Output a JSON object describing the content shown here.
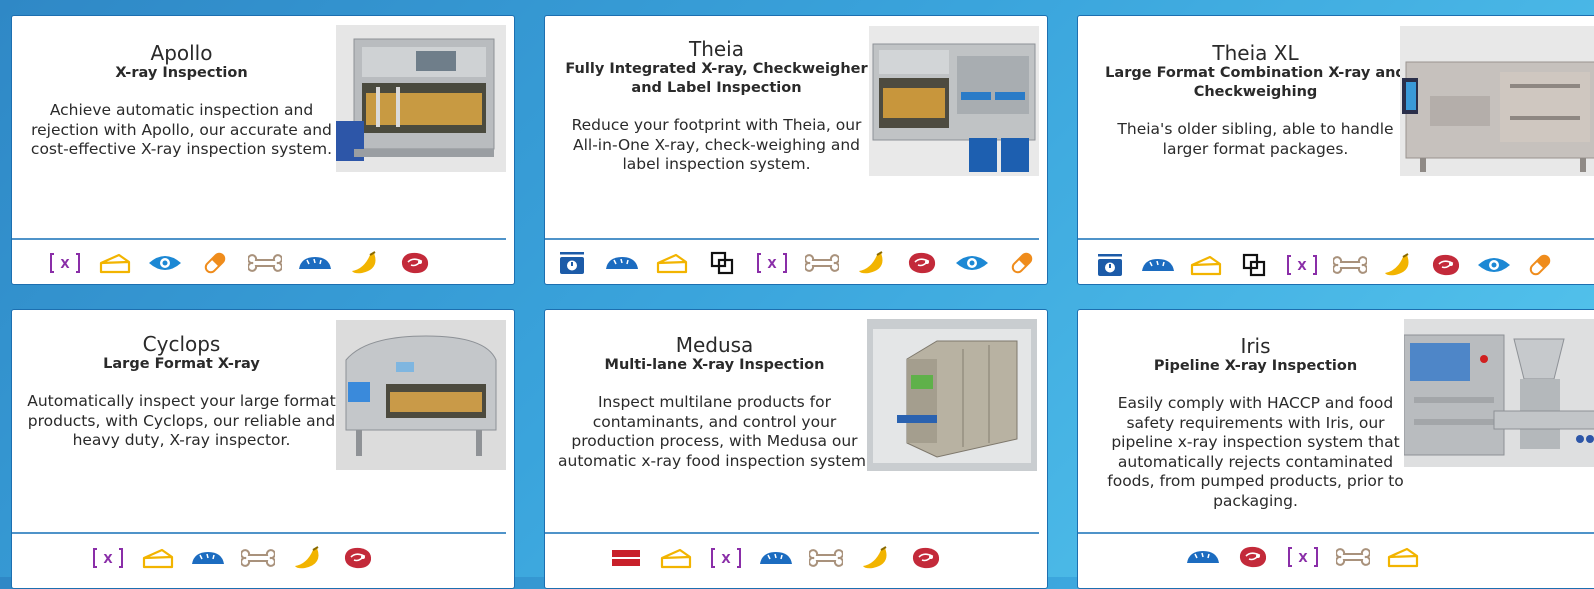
{
  "colors": {
    "xray": "#8a2ea8",
    "cheese": "#f2b400",
    "eye": "#1c88d4",
    "pill": "#ef8c1c",
    "bone": "#a9927c",
    "bread": "#1c6cc0",
    "banana": "#f2b400",
    "meat": "#c32a3a",
    "weight": "#1c5ba8",
    "label": "#111111",
    "flag": "#c8202a"
  },
  "cards": [
    {
      "title": "Apollo",
      "subtitle": "X-ray Inspection",
      "description": "Achieve automatic inspection and rejection with Apollo, our accurate and cost-effective X-ray inspection system.",
      "image": "apollo-machine-photo",
      "icons": [
        "xray-icon",
        "cheese-icon",
        "eye-icon",
        "pill-icon",
        "bone-icon",
        "bread-icon",
        "banana-icon",
        "meat-icon"
      ]
    },
    {
      "title": "Theia",
      "subtitle": "Fully Integrated X-ray, Checkweigher and Label Inspection",
      "description": "Reduce your footprint with Theia, our All-in-One X-ray, check-weighing and label inspection system.",
      "image": "theia-machine-photo",
      "icons": [
        "weight-icon",
        "bread-icon",
        "cheese-icon",
        "label-icon",
        "xray-icon",
        "bone-icon",
        "banana-icon",
        "meat-icon",
        "eye-icon",
        "pill-icon"
      ]
    },
    {
      "title": "Theia XL",
      "subtitle": "Large Format Combination X-ray and Checkweighing",
      "description": "Theia's older sibling, able to handle larger format packages.",
      "image": "theia-xl-machine-photo",
      "icons": [
        "weight-icon",
        "bread-icon",
        "cheese-icon",
        "label-icon",
        "xray-icon",
        "bone-icon",
        "banana-icon",
        "meat-icon",
        "eye-icon",
        "pill-icon"
      ]
    },
    {
      "title": "Cyclops",
      "subtitle": "Large Format X-ray",
      "description": "Automatically inspect your large format products, with Cyclops, our reliable and heavy duty, X-ray inspector.",
      "image": "cyclops-machine-photo",
      "icons": [
        "xray-icon",
        "cheese-icon",
        "bread-icon",
        "bone-icon",
        "banana-icon",
        "meat-icon"
      ]
    },
    {
      "title": "Medusa",
      "subtitle": "Multi-lane X-ray Inspection",
      "description": "Inspect multilane products for contaminants, and control your production process, with Medusa our automatic x-ray food inspection system.",
      "image": "medusa-machine-photo",
      "icons": [
        "multilane-icon",
        "cheese-icon",
        "xray-icon",
        "bread-icon",
        "bone-icon",
        "banana-icon",
        "meat-icon"
      ]
    },
    {
      "title": "Iris",
      "subtitle": "Pipeline X-ray Inspection",
      "description": "Easily comply with HACCP and food safety requirements with Iris, our pipeline x-ray inspection system that automatically rejects contaminated foods, from pumped products, prior to packaging.",
      "image": "iris-machine-photo",
      "icons": [
        "bread-icon",
        "meat-icon",
        "xray-icon",
        "bone-icon",
        "cheese-icon"
      ]
    }
  ]
}
